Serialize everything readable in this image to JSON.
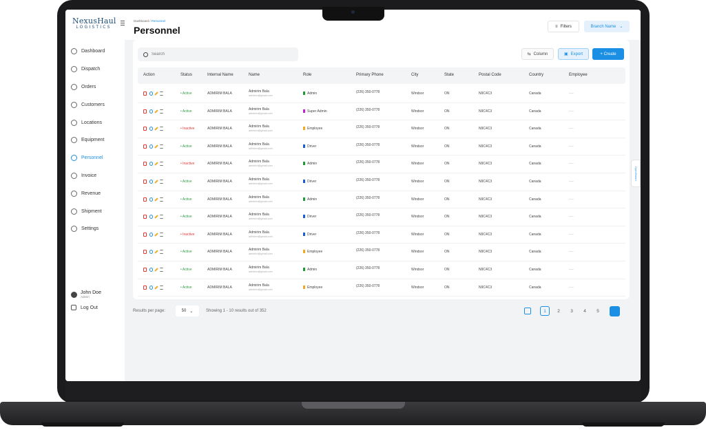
{
  "brand": {
    "name": "NexusHaul",
    "sub": "LOGISTICS"
  },
  "sidebar": {
    "items": [
      {
        "label": "Dashboard",
        "icon": "dashboard-icon"
      },
      {
        "label": "Dispatch",
        "icon": "dispatch-icon"
      },
      {
        "label": "Orders",
        "icon": "orders-icon"
      },
      {
        "label": "Customers",
        "icon": "customers-icon"
      },
      {
        "label": "Locations",
        "icon": "locations-icon"
      },
      {
        "label": "Equipment",
        "icon": "equipment-icon"
      },
      {
        "label": "Personnel",
        "icon": "personnel-icon",
        "active": true
      },
      {
        "label": "Invoice",
        "icon": "invoice-icon"
      },
      {
        "label": "Revenue",
        "icon": "revenue-icon"
      },
      {
        "label": "Shipment",
        "icon": "shipment-icon"
      },
      {
        "label": "Settings",
        "icon": "settings-icon"
      }
    ],
    "user": {
      "name": "John Doe",
      "role": "Admin"
    },
    "logout": "Log Out"
  },
  "header": {
    "breadcrumb_root": "Dashboard /",
    "breadcrumb_current": "Personnel",
    "title": "Personnel",
    "filters": "Filters",
    "branch": "Branch Name"
  },
  "toolbar": {
    "search_placeholder": "Search",
    "column": "Column",
    "export": "Export",
    "create": "+ Create"
  },
  "table": {
    "columns": [
      "Action",
      "Status",
      "Internal Name",
      "Name",
      "Role",
      "Primary Phone",
      "City",
      "State",
      "Postal Code",
      "Country",
      "Employee"
    ],
    "rows": [
      {
        "status": "• Active",
        "internal": "ADMIRIM BALA",
        "name": "Admirim Bala",
        "email": "admirim@gmail.com",
        "role": "Admin",
        "phone": "(226) 350-0778",
        "city": "Windsor",
        "state": "ON",
        "postal": "N9C4C3",
        "country": "Canada",
        "employee": "----"
      },
      {
        "status": "• Active",
        "internal": "ADMIRIM BALA",
        "name": "Admirim Bala",
        "email": "admirim@gmail.com",
        "role": "Super Admin",
        "phone": "(226) 350-0778",
        "city": "Windsor",
        "state": "ON",
        "postal": "N9C4C3",
        "country": "Canada",
        "employee": "----"
      },
      {
        "status": "• Inactive",
        "internal": "ADMIRIM BALA",
        "name": "Admirim Bala",
        "email": "admirim@gmail.com",
        "role": "Employee",
        "phone": "(226) 350-0778",
        "city": "Windsor",
        "state": "ON",
        "postal": "N9C4C3",
        "country": "Canada",
        "employee": "----"
      },
      {
        "status": "• Active",
        "internal": "ADMIRIM BALA",
        "name": "Admirim Bala",
        "email": "admirim@gmail.com",
        "role": "Driver",
        "phone": "(226) 350-0778",
        "city": "Windsor",
        "state": "ON",
        "postal": "N9C4C3",
        "country": "Canada",
        "employee": "----"
      },
      {
        "status": "• Inactive",
        "internal": "ADMIRIM BALA",
        "name": "Admirim Bala",
        "email": "admirim@gmail.com",
        "role": "Admin",
        "phone": "(226) 350-0778",
        "city": "Windsor",
        "state": "ON",
        "postal": "N9C4C3",
        "country": "Canada",
        "employee": "----"
      },
      {
        "status": "• Active",
        "internal": "ADMIRIM BALA",
        "name": "Admirim Bala",
        "email": "admirim@gmail.com",
        "role": "Driver",
        "phone": "(226) 350-0778",
        "city": "Windsor",
        "state": "ON",
        "postal": "N9C4C3",
        "country": "Canada",
        "employee": "----"
      },
      {
        "status": "• Active",
        "internal": "ADMIRIM BALA",
        "name": "Admirim Bala",
        "email": "admirim@gmail.com",
        "role": "Admin",
        "phone": "(226) 350-0778",
        "city": "Windsor",
        "state": "ON",
        "postal": "N9C4C3",
        "country": "Canada",
        "employee": "----"
      },
      {
        "status": "• Active",
        "internal": "ADMIRIM BALA",
        "name": "Admirim Bala",
        "email": "admirim@gmail.com",
        "role": "Driver",
        "phone": "(226) 350-0778",
        "city": "Windsor",
        "state": "ON",
        "postal": "N9C4C3",
        "country": "Canada",
        "employee": "----"
      },
      {
        "status": "• Inactive",
        "internal": "ADMIRIM BALA",
        "name": "Admirim Bala",
        "email": "admirim@gmail.com",
        "role": "Driver",
        "phone": "(226) 350-0778",
        "city": "Windsor",
        "state": "ON",
        "postal": "N9C4C3",
        "country": "Canada",
        "employee": "----"
      },
      {
        "status": "• Active",
        "internal": "ADMIRIM BALA",
        "name": "Admirim Bala",
        "email": "admirim@gmail.com",
        "role": "Employee",
        "phone": "(226) 350-0778",
        "city": "Windsor",
        "state": "ON",
        "postal": "N9C4C3",
        "country": "Canada",
        "employee": "----"
      },
      {
        "status": "• Active",
        "internal": "ADMIRIM BALA",
        "name": "Admirim Bala",
        "email": "admirim@gmail.com",
        "role": "Admin",
        "phone": "(226) 350-0778",
        "city": "Windsor",
        "state": "ON",
        "postal": "N9C4C3",
        "country": "Canada",
        "employee": "----"
      },
      {
        "status": "• Active",
        "internal": "ADMIRIM BALA",
        "name": "Admirim Bala",
        "email": "admirim@gmail.com",
        "role": "Employee",
        "phone": "(226) 350-0778",
        "city": "Windsor",
        "state": "ON",
        "postal": "N9C4C3",
        "country": "Canada",
        "employee": "----"
      }
    ]
  },
  "pagination": {
    "rpp_label": "Results per page:",
    "rpp_value": "50",
    "showing": "Showing 1 - 10 results out of 352",
    "pages": [
      "1",
      "2",
      "3",
      "4",
      "5"
    ],
    "active_page": "1"
  },
  "side_tab": "Open Branch",
  "colors": {
    "accent": "#1a8fe3",
    "active": "#2e9e44",
    "inactive": "#e53935",
    "role_admin": "#1e9c3a",
    "role_super_admin": "#c41ed6",
    "role_employee": "#f5a623",
    "role_driver": "#1c5bd8"
  }
}
